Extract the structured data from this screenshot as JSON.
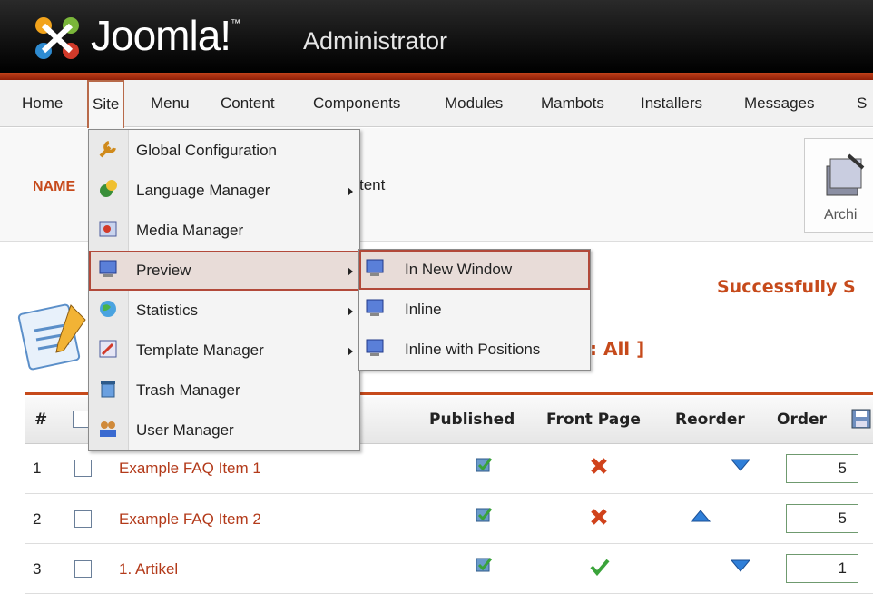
{
  "header": {
    "logo_text": "Joomla!",
    "trademark": "™",
    "subtitle": "Administrator"
  },
  "menubar": {
    "items": [
      "Home",
      "Site",
      "Menu",
      "Content",
      "Components",
      "Modules",
      "Mambots",
      "Installers",
      "Messages",
      "S"
    ],
    "active": "Site"
  },
  "toolbar": {
    "name_label": "NAME",
    "tent_fragment": "tent",
    "archive_label": "Archi"
  },
  "status": {
    "success_text": "Successfully S",
    "section_text": ": All ]"
  },
  "site_menu": {
    "items": [
      {
        "label": "Global Configuration",
        "icon": "wrench-icon",
        "has_submenu": false
      },
      {
        "label": "Language Manager",
        "icon": "language-icon",
        "has_submenu": true
      },
      {
        "label": "Media Manager",
        "icon": "media-icon",
        "has_submenu": false
      },
      {
        "label": "Preview",
        "icon": "monitor-icon",
        "has_submenu": true
      },
      {
        "label": "Statistics",
        "icon": "globe-icon",
        "has_submenu": true
      },
      {
        "label": "Template Manager",
        "icon": "template-icon",
        "has_submenu": true
      },
      {
        "label": "Trash Manager",
        "icon": "trash-icon",
        "has_submenu": false
      },
      {
        "label": "User Manager",
        "icon": "users-icon",
        "has_submenu": false
      }
    ],
    "highlighted": "Preview"
  },
  "preview_submenu": {
    "items": [
      {
        "label": "In New Window",
        "icon": "monitor-icon"
      },
      {
        "label": "Inline",
        "icon": "monitor-icon"
      },
      {
        "label": "Inline with Positions",
        "icon": "monitor-icon"
      }
    ],
    "highlighted": "In New Window"
  },
  "table": {
    "headers": {
      "number": "#",
      "published": "Published",
      "front_page": "Front Page",
      "reorder": "Reorder",
      "order": "Order"
    },
    "rows": [
      {
        "num": "1",
        "title": "Example FAQ Item 1",
        "published": "published-icon",
        "front_page": "no",
        "reorder": [
          "down"
        ],
        "order": "5"
      },
      {
        "num": "2",
        "title": "Example FAQ Item 2",
        "published": "published-icon",
        "front_page": "no",
        "reorder": [
          "up"
        ],
        "order": "5"
      },
      {
        "num": "3",
        "title": "1. Artikel",
        "published": "published-icon",
        "front_page": "yes",
        "reorder": [
          "down"
        ],
        "order": "1"
      }
    ]
  },
  "colors": {
    "accent": "#c64a1b",
    "header_bg": "#000000",
    "menu_bg": "#f1f1f1",
    "link": "#b33a1a"
  }
}
